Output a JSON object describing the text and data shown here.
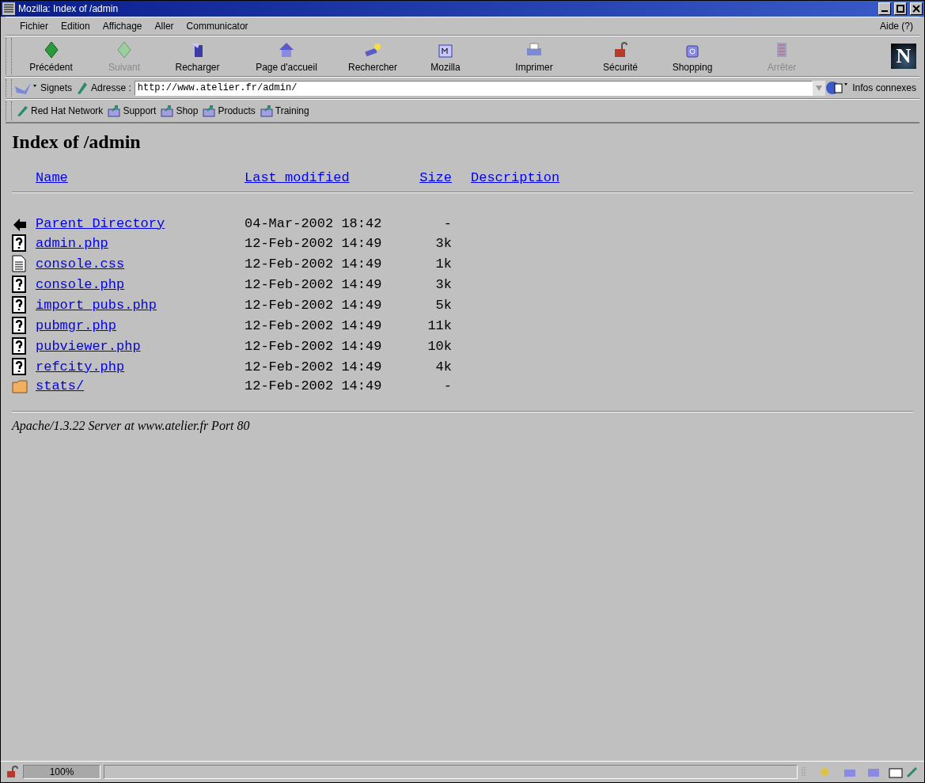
{
  "window": {
    "title": "Mozilla: Index of /admin"
  },
  "menu": {
    "items": [
      "Fichier",
      "Edition",
      "Affichage",
      "Aller",
      "Communicator"
    ],
    "help": "Aide (?)"
  },
  "toolbar": [
    {
      "label": "Précédent",
      "kind": "back",
      "disabled": false
    },
    {
      "label": "Suivant",
      "kind": "forward",
      "disabled": true
    },
    {
      "label": "Recharger",
      "kind": "reload",
      "disabled": false
    },
    {
      "label": "Page d'accueil",
      "kind": "home",
      "disabled": false
    },
    {
      "label": "Rechercher",
      "kind": "search",
      "disabled": false
    },
    {
      "label": "Mozilla",
      "kind": "mozilla",
      "disabled": false
    },
    {
      "label": "Imprimer",
      "kind": "print",
      "disabled": false
    },
    {
      "label": "Sécurité",
      "kind": "security",
      "disabled": false
    },
    {
      "label": "Shopping",
      "kind": "shopping",
      "disabled": false
    },
    {
      "label": "Arrêter",
      "kind": "stop",
      "disabled": true
    }
  ],
  "logo": "N",
  "location": {
    "bookmarks": "Signets",
    "address_label": "Adresse :",
    "url": "http://www.atelier.fr/admin/",
    "related": "Infos connexes"
  },
  "personal_toolbar": [
    {
      "label": "Red Hat Network",
      "kind": "pen"
    },
    {
      "label": "Support",
      "kind": "bookmark"
    },
    {
      "label": "Shop",
      "kind": "bookmark"
    },
    {
      "label": "Products",
      "kind": "bookmark"
    },
    {
      "label": "Training",
      "kind": "bookmark"
    }
  ],
  "page": {
    "heading": "Index of /admin",
    "columns": [
      "Name",
      "Last modified",
      "Size",
      "Description"
    ],
    "rows": [
      {
        "kind": "parent",
        "name": "Parent Directory",
        "modified": "04-Mar-2002 18:42",
        "size": "-"
      },
      {
        "kind": "unknown",
        "name": "admin.php",
        "modified": "12-Feb-2002 14:49",
        "size": "3k"
      },
      {
        "kind": "text",
        "name": "console.css",
        "modified": "12-Feb-2002 14:49",
        "size": "1k"
      },
      {
        "kind": "unknown",
        "name": "console.php",
        "modified": "12-Feb-2002 14:49",
        "size": "3k"
      },
      {
        "kind": "unknown",
        "name": "import_pubs.php",
        "modified": "12-Feb-2002 14:49",
        "size": "5k"
      },
      {
        "kind": "unknown",
        "name": "pubmgr.php",
        "modified": "12-Feb-2002 14:49",
        "size": "11k"
      },
      {
        "kind": "unknown",
        "name": "pubviewer.php",
        "modified": "12-Feb-2002 14:49",
        "size": "10k"
      },
      {
        "kind": "unknown",
        "name": "refcity.php",
        "modified": "12-Feb-2002 14:49",
        "size": "4k"
      },
      {
        "kind": "folder",
        "name": "stats/",
        "modified": "12-Feb-2002 14:49",
        "size": "-"
      }
    ],
    "address": "Apache/1.3.22 Server at www.atelier.fr Port 80"
  },
  "status_bar": {
    "progress": "100%",
    "level": 1
  }
}
